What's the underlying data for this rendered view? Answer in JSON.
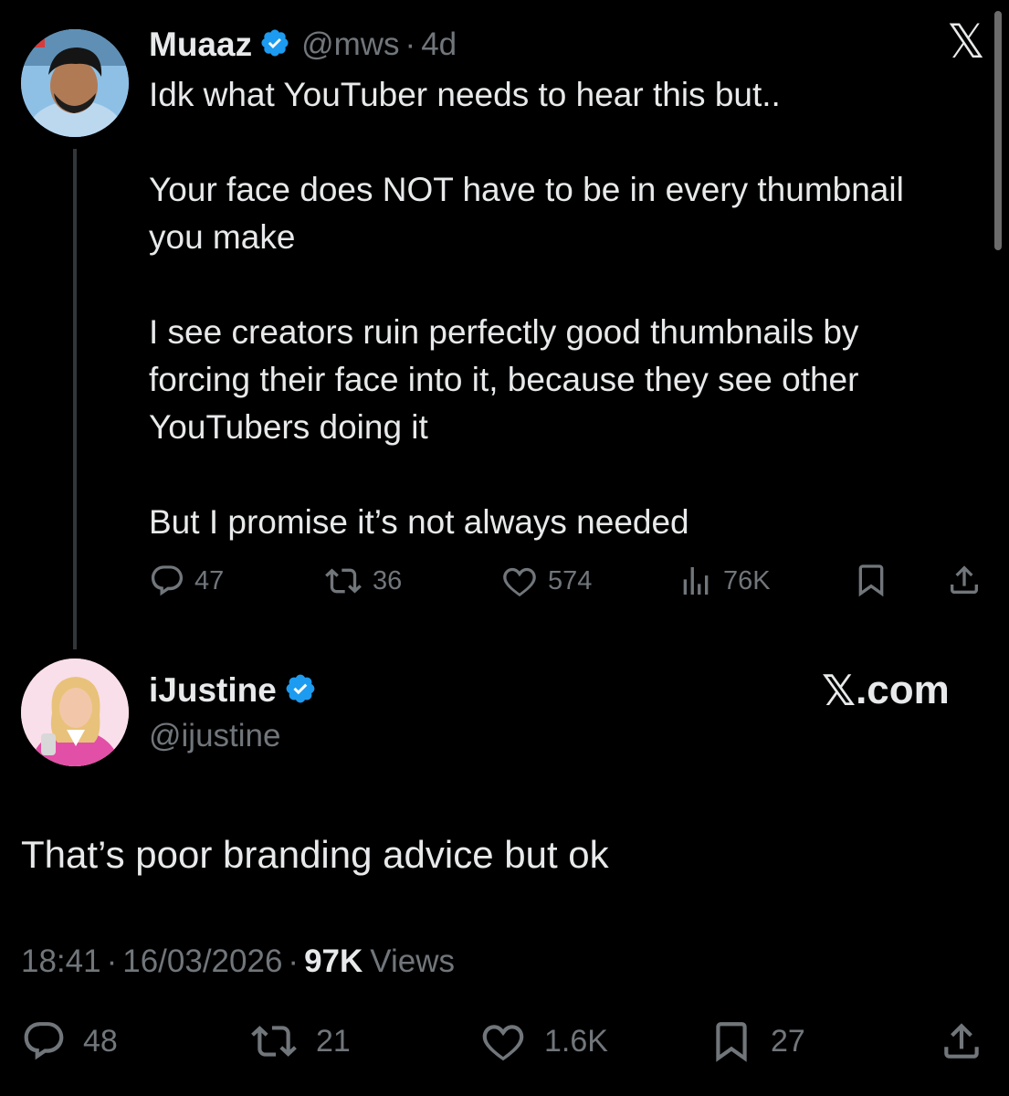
{
  "parent": {
    "author_name": "Muaaz",
    "handle": "@mws",
    "separator": "·",
    "age": "4d",
    "text": "Idk what YouTuber needs to hear this but..\n\nYour face does NOT have to be in every thumbnail\nyou make\n\nI see creators ruin perfectly good thumbnails by\nforcing their face into it, because they see other\nYouTubers doing it\n\nBut I promise it’s not always needed",
    "replies": "47",
    "reposts": "36",
    "likes": "574",
    "views": "76K",
    "icons": [
      "reply-icon",
      "repost-icon",
      "like-icon",
      "views-icon",
      "bookmark-icon",
      "share-icon"
    ]
  },
  "close_glyph": "𝕏",
  "reply": {
    "author_name": "iJustine",
    "handle": "@ijustine",
    "text": "That’s poor branding advice but ok",
    "time": "18:41",
    "date": "16/03/2026",
    "sep1": "·",
    "sep2": "·",
    "views_count": "97K",
    "views_label": "Views",
    "replies": "48",
    "reposts": "21",
    "likes": "1.6K",
    "bookmarks": "27"
  },
  "watermark": {
    "glyph": "𝕏",
    "text": ".com"
  },
  "colors": {
    "background": "#000000",
    "text": "#e7e9ea",
    "muted": "#71767b",
    "verified": "#1d9bf0"
  }
}
